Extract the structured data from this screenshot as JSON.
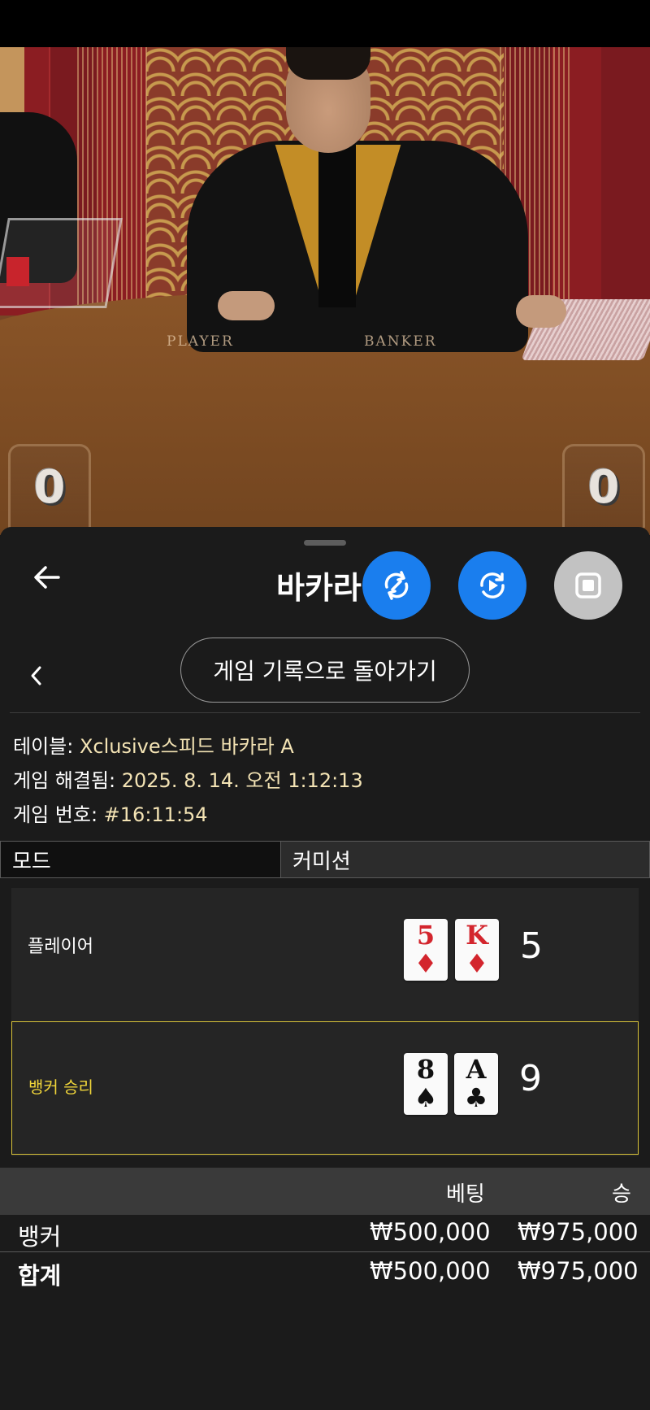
{
  "video": {
    "felt_player": "PLAYER",
    "felt_banker": "BANKER",
    "player_score": "0",
    "banker_score": "0"
  },
  "header": {
    "title": "바카라",
    "back_icon": "arrow-left-icon",
    "buttons": [
      {
        "icon": "rotate-sync-icon",
        "color": "#1a7eee"
      },
      {
        "icon": "replay-play-icon",
        "color": "#1a7eee"
      },
      {
        "icon": "stop-square-icon",
        "color": "#c2c2c2"
      }
    ]
  },
  "history": {
    "back_label": "게임 기록으로 돌아가기",
    "chevron_icon": "chevron-left-icon"
  },
  "info": {
    "table_label": "테이블: ",
    "table_value": "Xclusive스피드 바카라 A",
    "resolved_label": "게임 해결됨: ",
    "resolved_value": "2025. 8. 14. 오전 1:12:13",
    "number_label": "게임 번호: ",
    "number_value": "#16:11:54"
  },
  "mode": {
    "col1": "모드",
    "col2": "커미션"
  },
  "result": {
    "player": {
      "label": "플레이어",
      "cards": [
        {
          "rank": "5",
          "suit": "♦",
          "color": "red"
        },
        {
          "rank": "K",
          "suit": "♦",
          "color": "red"
        }
      ],
      "total": "5"
    },
    "banker": {
      "label": "뱅커 승리",
      "cards": [
        {
          "rank": "8",
          "suit": "♠",
          "color": "black"
        },
        {
          "rank": "A",
          "suit": "♣",
          "color": "black"
        }
      ],
      "total": "9"
    },
    "accent": "#d8c33a"
  },
  "bets": {
    "head_bet": "베팅",
    "head_win": "승",
    "rows": [
      {
        "name": "뱅커",
        "bet": "₩500,000",
        "win": "₩975,000"
      },
      {
        "name": "합계",
        "bet": "₩500,000",
        "win": "₩975,000"
      }
    ]
  }
}
